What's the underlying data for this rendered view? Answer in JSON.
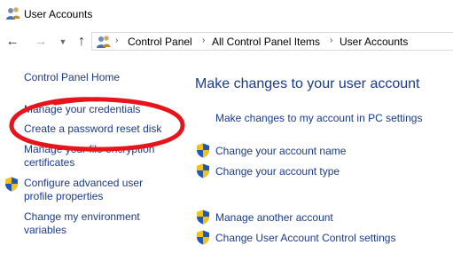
{
  "window": {
    "title": "User Accounts",
    "icon": "users-icon"
  },
  "navbar": {
    "back_icon": "arrow-left-icon",
    "forward_icon": "arrow-right-icon",
    "recent_icon": "chevron-down-icon",
    "up_icon": "arrow-up-icon",
    "breadcrumbs": [
      "Control Panel",
      "All Control Panel Items",
      "User Accounts"
    ]
  },
  "sidebar": {
    "home_label": "Control Panel Home",
    "items": [
      {
        "label": "Manage your credentials",
        "shield": false
      },
      {
        "label": "Create a password reset disk",
        "shield": false
      },
      {
        "label_line1": "Manage your file encryption",
        "label_line2": "certificates",
        "shield": false
      },
      {
        "label_line1": "Configure advanced user",
        "label_line2": "profile properties",
        "shield": true
      },
      {
        "label_line1": "Change my environment",
        "label_line2": "variables",
        "shield": false
      }
    ]
  },
  "main": {
    "heading": "Make changes to your user account",
    "pc_settings_link": "Make changes to my account in PC settings",
    "links": [
      {
        "label": "Change your account name",
        "shield": true
      },
      {
        "label": "Change your account type",
        "shield": true
      },
      {
        "label": "Manage another account",
        "shield": true
      },
      {
        "label": "Change User Account Control settings",
        "shield": true
      }
    ]
  },
  "annotation": {
    "color": "#e8141b",
    "target": "Create a password reset disk"
  }
}
